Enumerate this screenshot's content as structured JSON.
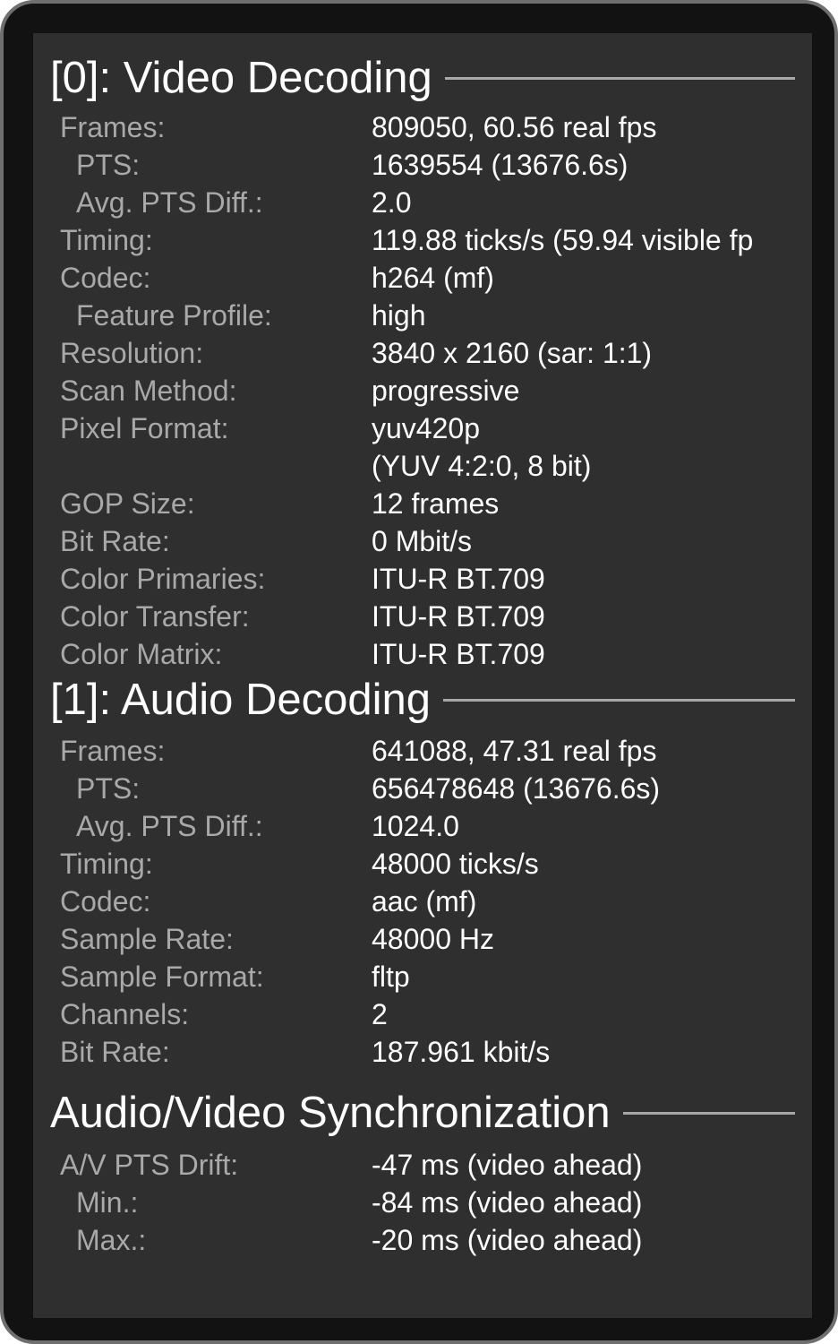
{
  "sections": [
    {
      "title": "[0]: Video Decoding",
      "rows": [
        {
          "label": "Frames:",
          "value": "809050, 60.56 real fps"
        },
        {
          "label": "PTS:",
          "value": "1639554 (13676.6s)"
        },
        {
          "label": "Avg. PTS Diff.:",
          "value": "2.0"
        },
        {
          "label": "Timing:",
          "value": "119.88 ticks/s (59.94 visible fp"
        },
        {
          "label": "Codec:",
          "value": "h264 (mf)"
        },
        {
          "label": "Feature Profile:",
          "value": "high"
        },
        {
          "label": "Resolution:",
          "value": "3840 x 2160 (sar: 1:1)"
        },
        {
          "label": "Scan Method:",
          "value": "progressive"
        },
        {
          "label": "Pixel Format:",
          "value": "yuv420p"
        },
        {
          "label": "",
          "value": "(YUV 4:2:0, 8 bit)"
        },
        {
          "label": "GOP Size:",
          "value": "12 frames"
        },
        {
          "label": "Bit Rate:",
          "value": "0 Mbit/s"
        },
        {
          "label": "Color Primaries:",
          "value": "ITU-R BT.709"
        },
        {
          "label": "Color Transfer:",
          "value": "ITU-R BT.709"
        },
        {
          "label": "Color Matrix:",
          "value": "ITU-R BT.709"
        }
      ]
    },
    {
      "title": "[1]: Audio Decoding",
      "rows": [
        {
          "label": "Frames:",
          "value": "641088, 47.31 real fps"
        },
        {
          "label": "PTS:",
          "value": "656478648 (13676.6s)"
        },
        {
          "label": "Avg. PTS Diff.:",
          "value": "1024.0"
        },
        {
          "label": "Timing:",
          "value": "48000 ticks/s"
        },
        {
          "label": "Codec:",
          "value": "aac (mf)"
        },
        {
          "label": "Sample Rate:",
          "value": "48000 Hz"
        },
        {
          "label": "Sample Format:",
          "value": "fltp"
        },
        {
          "label": "Channels:",
          "value": "2"
        },
        {
          "label": "Bit Rate:",
          "value": "187.961 kbit/s"
        }
      ]
    },
    {
      "title": "Audio/Video Synchronization",
      "rows": [
        {
          "label": "A/V PTS Drift:",
          "value": "-47 ms (video ahead)"
        },
        {
          "label": "Min.:",
          "value": "-84 ms (video ahead)"
        },
        {
          "label": "Max.:",
          "value": "-20 ms (video ahead)"
        }
      ]
    }
  ]
}
